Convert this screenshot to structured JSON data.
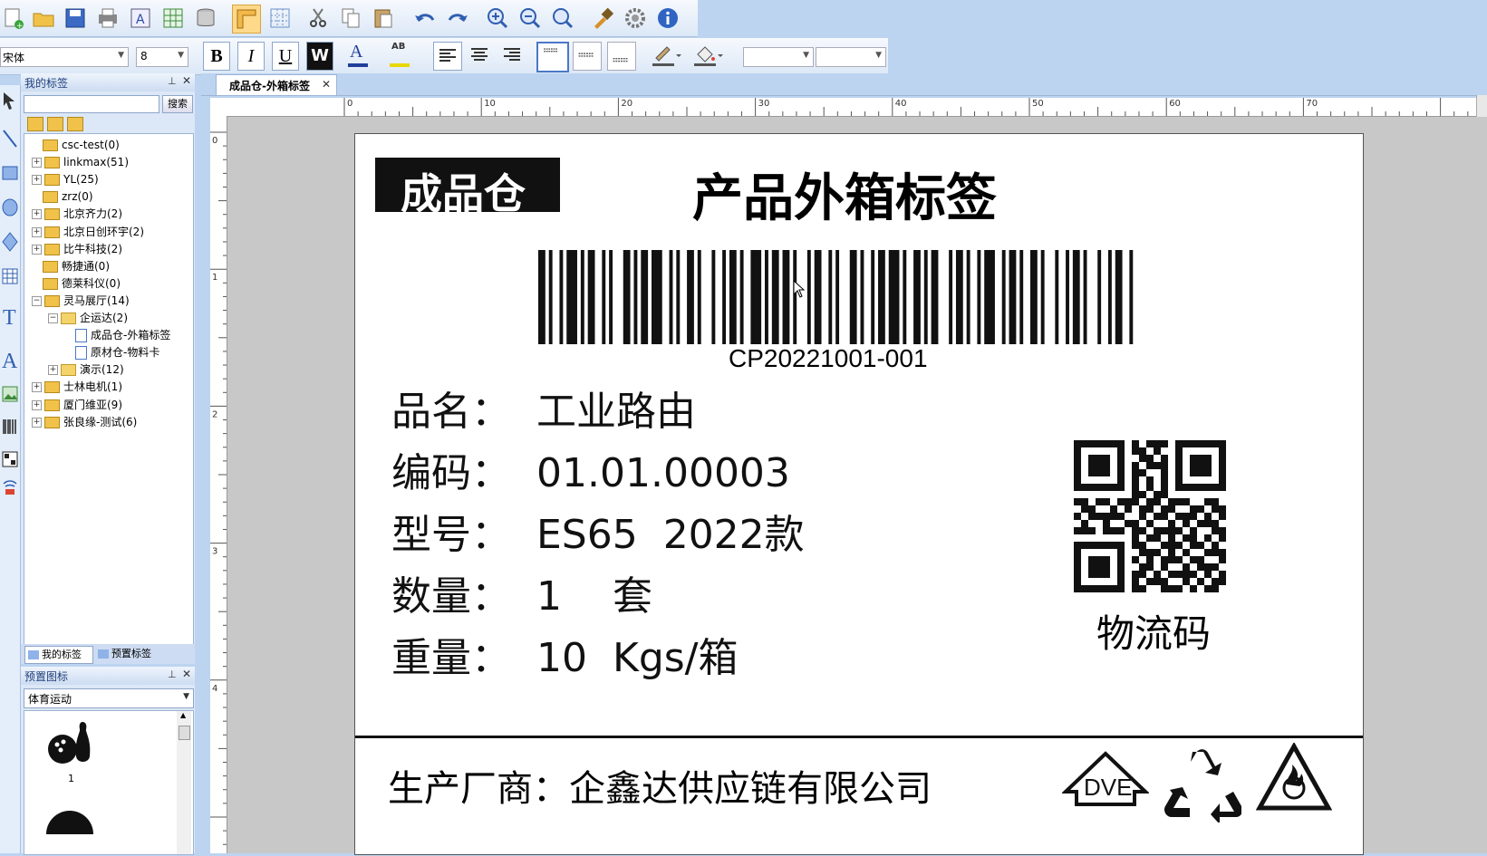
{
  "toolbar": {
    "font_name": "宋体",
    "font_size": "8",
    "bold_label": "B",
    "italic_label": "I",
    "underline_label": "U",
    "wordwrap_label": "W",
    "fontcolor_label": "A",
    "highlight_label": "AB"
  },
  "left_panel": {
    "title": "我的标签",
    "search_button": "搜索",
    "search_placeholder": "",
    "tree": [
      {
        "label": "csc-test(0)"
      },
      {
        "label": "linkmax(51)"
      },
      {
        "label": "YL(25)"
      },
      {
        "label": "zrz(0)"
      },
      {
        "label": "北京齐力(2)"
      },
      {
        "label": "北京日创环宇(2)"
      },
      {
        "label": "比牛科技(2)"
      },
      {
        "label": "畅捷通(0)"
      },
      {
        "label": "德莱科仪(0)"
      },
      {
        "label": "灵马展厅(14)"
      },
      {
        "label": "企运达(2)"
      },
      {
        "label": "成品仓-外箱标签"
      },
      {
        "label": "原材仓-物料卡"
      },
      {
        "label": "演示(12)"
      },
      {
        "label": "士林电机(1)"
      },
      {
        "label": "厦门维亚(9)"
      },
      {
        "label": "张良缘-测试(6)"
      }
    ],
    "tab_my": "我的标签",
    "tab_preset": "预置标签"
  },
  "icon_panel": {
    "title": "预置图标",
    "category": "体育运动",
    "items": [
      {
        "label": "1"
      }
    ]
  },
  "document": {
    "tab_title": "成品仓-外箱标签",
    "ruler_top": [
      "0",
      "10",
      "20",
      "30",
      "40",
      "50",
      "60",
      "70"
    ],
    "ruler_left": [
      "0",
      "1",
      "2",
      "3",
      "4"
    ]
  },
  "label": {
    "warehouse": "成品仓",
    "title": "产品外箱标签",
    "barcode_text": "CP20221001-001",
    "rows": [
      {
        "key": "品名：",
        "value": "工业路由"
      },
      {
        "key": "编码：",
        "value": "01.01.00003"
      },
      {
        "key": "型号：",
        "value": "ES65  2022款"
      },
      {
        "key": "数量：",
        "value": "1    套"
      },
      {
        "key": "重量：",
        "value": "10  Kgs/箱"
      }
    ],
    "qr_caption": "物流码",
    "manufacturer": "生产厂商：企鑫达供应链有限公司",
    "mark_dve": "DVE"
  },
  "colors": {
    "app_bg": "#bcd4f0",
    "canvas_bg": "#c8c8c8",
    "accent": "#1f5fbf"
  }
}
